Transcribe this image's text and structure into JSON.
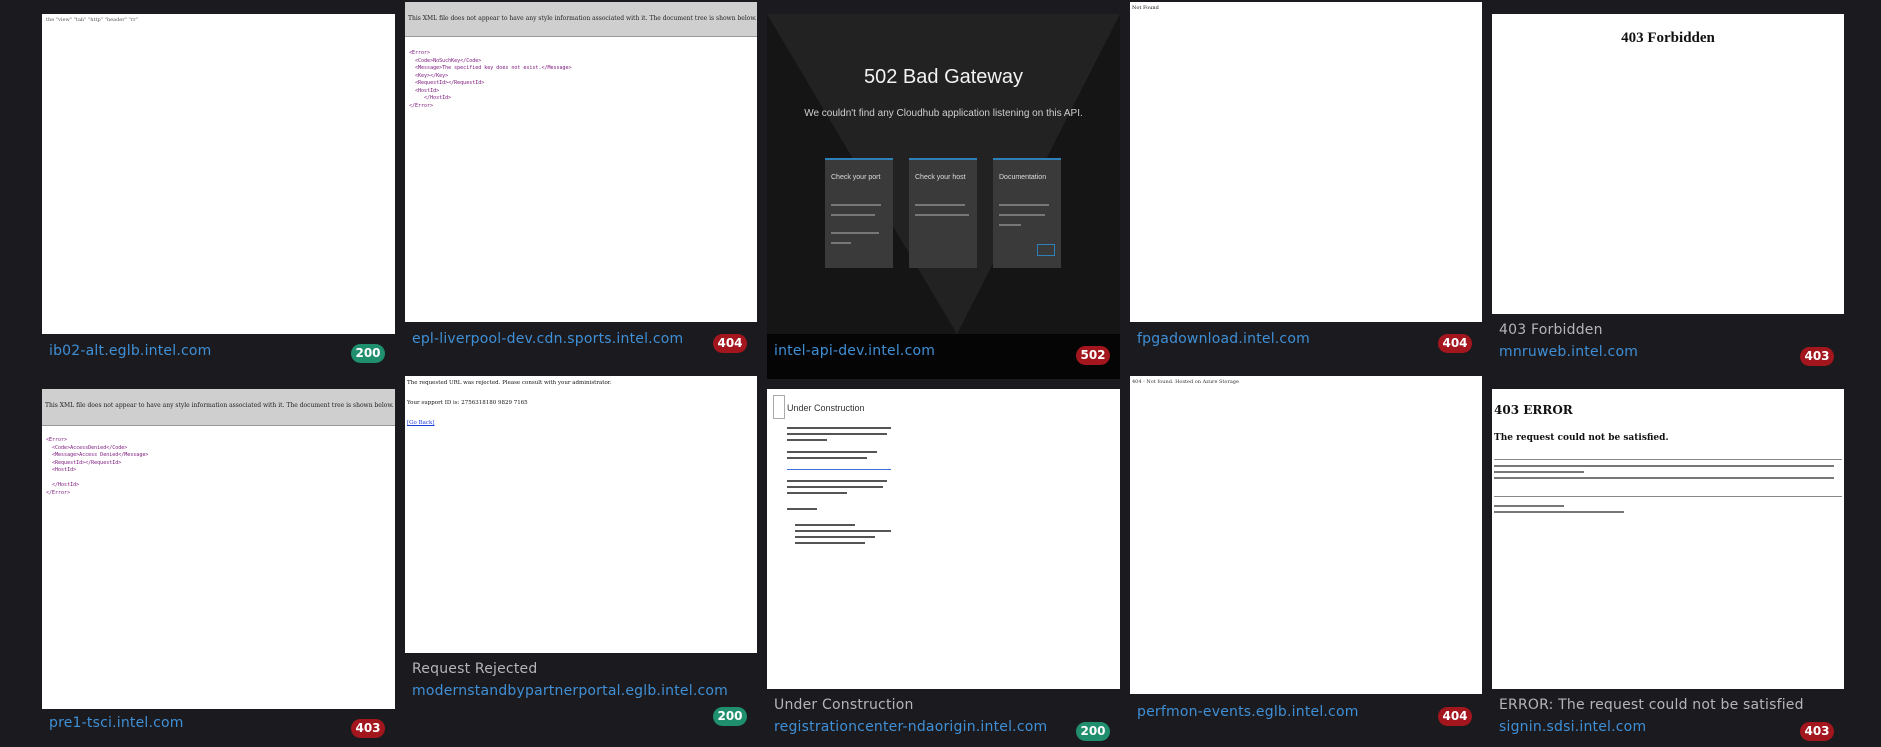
{
  "cards": [
    {
      "title": "",
      "host": "ib02-alt.eglb.intel.com",
      "status": "200",
      "preview_text": "the \"view\" \"tab\" \"http\" \"header\" \"rr\""
    },
    {
      "title": "",
      "host": "epl-liverpool-dev.cdn.sports.intel.com",
      "status": "404",
      "preview_text": "This XML file does not appear to have any style information associated with it. The document tree is shown below."
    },
    {
      "title": "",
      "host": "intel-api-dev.intel.com",
      "status": "502",
      "preview_title": "502 Bad Gateway",
      "preview_sub": "We couldn't find any Cloudhub application listening on this API.",
      "preview_boxes": [
        "Check your port",
        "Check your host",
        "Documentation"
      ]
    },
    {
      "title": "",
      "host": "fpgadownload.intel.com",
      "status": "404",
      "preview_text": "Not Found"
    },
    {
      "title": "403 Forbidden",
      "host": "mnruweb.intel.com",
      "status": "403",
      "preview_title": "403 Forbidden"
    },
    {
      "title": "",
      "host": "pre1-tsci.intel.com",
      "status": "403",
      "preview_text": "This XML file does not appear to have any style information associated with it. The document tree is shown below."
    },
    {
      "title": "Request Rejected",
      "host": "modernstandbypartnerportal.eglb.intel.com",
      "status": "200",
      "preview_text": "The requested URL was rejected. Please consult with your administrator.",
      "preview_sub": "Your support ID is: 2756318180 9829 7165",
      "preview_link": "[Go Back]"
    },
    {
      "title": "Under Construction",
      "host": "registrationcenter-ndaorigin.intel.com",
      "status": "200",
      "preview_title": "Under Construction"
    },
    {
      "title": "",
      "host": "perfmon-events.eglb.intel.com",
      "status": "404",
      "preview_text": "404 - Not found. Hosted on Azure Storage"
    },
    {
      "title": "ERROR: The request could not be satisfied",
      "host": "signin.sdsi.intel.com",
      "status": "403",
      "preview_title": "403 ERROR",
      "preview_sub": "The request could not be satisfied."
    }
  ]
}
